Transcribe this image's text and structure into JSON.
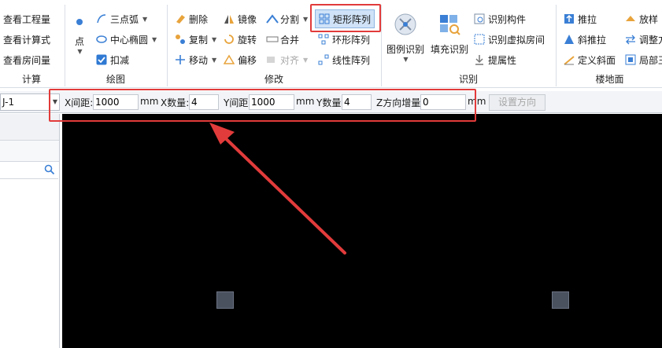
{
  "ribbon": {
    "calc": {
      "label": "计算",
      "items": [
        "查看工程量",
        "查看计算式",
        "查看房间量"
      ]
    },
    "draw": {
      "label": "绘图",
      "point": "点",
      "arc": "三点弧",
      "ellipse": "中心椭圆",
      "deduct": "扣减"
    },
    "modify": {
      "label": "修改",
      "delete": "删除",
      "mirror": "镜像",
      "split": "分割",
      "rect_array": "矩形阵列",
      "copy": "复制",
      "rotate": "旋转",
      "merge": "合并",
      "ring_array": "环形阵列",
      "move": "移动",
      "offset": "偏移",
      "align": "对齐",
      "linear_array": "线性阵列"
    },
    "identify": {
      "label": "识别",
      "legend": "图例识别",
      "fill": "填充识别",
      "component": "识别构件",
      "virtual_room": "识别虚拟房间",
      "attr": "提属性"
    },
    "floor": {
      "label": "楼地面",
      "push": "推拉",
      "slope_push": "斜推拉",
      "def_slope": "定义斜面",
      "loft": "放样",
      "adjust": "调整方",
      "local": "局部王"
    }
  },
  "toolbar": {
    "combo_value": "J-1",
    "x_spacing_label": "X间距:",
    "x_spacing": "1000",
    "mm1": "mm",
    "x_count_label": "X数量:",
    "x_count": "4",
    "y_spacing_label": "Y间距",
    "y_spacing": "1000",
    "mm2": "mm",
    "y_count_label": "Y数量",
    "y_count": "4",
    "z_inc_label": "Z方向增量",
    "z_inc": "0",
    "mm3": "mm",
    "set_direction": "设置方向"
  },
  "colors": {
    "accent_red": "#e23b3b",
    "canvas_bg": "#000000",
    "selected_bg": "#cfe2f7"
  }
}
